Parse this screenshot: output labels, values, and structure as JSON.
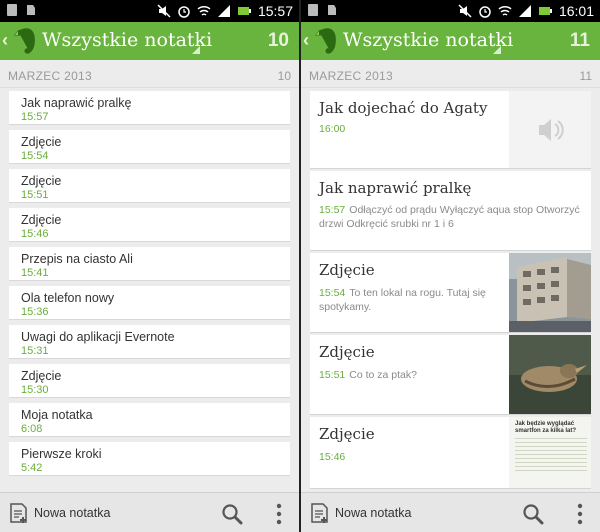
{
  "left": {
    "status_time": "15:57",
    "title": "Wszystkie notatki",
    "count": "10",
    "section": {
      "month": "MARZEC 2013",
      "count": "10"
    },
    "notes": [
      {
        "title": "Jak naprawić pralkę",
        "time": "15:57"
      },
      {
        "title": "Zdjęcie",
        "time": "15:54"
      },
      {
        "title": "Zdjęcie",
        "time": "15:51"
      },
      {
        "title": "Zdjęcie",
        "time": "15:46"
      },
      {
        "title": "Przepis na ciasto Ali",
        "time": "15:41"
      },
      {
        "title": "Ola telefon nowy",
        "time": "15:36"
      },
      {
        "title": "Uwagi do aplikacji Evernote",
        "time": "15:31"
      },
      {
        "title": "Zdjęcie",
        "time": "15:30"
      },
      {
        "title": "Moja notatka",
        "time": "6:08"
      },
      {
        "title": "Pierwsze kroki",
        "time": "5:42"
      }
    ],
    "new_note_label": "Nowa notatka"
  },
  "right": {
    "status_time": "16:01",
    "title": "Wszystkie notatki",
    "count": "11",
    "section": {
      "month": "MARZEC 2013",
      "count": "11"
    },
    "notes": [
      {
        "title": "Jak dojechać do Agaty",
        "time": "16:00",
        "snippet": "",
        "thumb": "audio-icon"
      },
      {
        "title": "Jak naprawić pralkę",
        "time": "15:57",
        "snippet": "Odłączyć od prądu Wyłączyć aqua stop Otworzyć drzwi Odkręcić srubki nr 1 i 6",
        "thumb": ""
      },
      {
        "title": "Zdjęcie",
        "time": "15:54",
        "snippet": "To ten lokal na rogu. Tutaj się spotykamy.",
        "thumb": "building-photo"
      },
      {
        "title": "Zdjęcie",
        "time": "15:51",
        "snippet": "Co to za ptak?",
        "thumb": "bird-photo"
      },
      {
        "title": "Zdjęcie",
        "time": "15:46",
        "snippet": "",
        "thumb": "article-photo"
      }
    ],
    "article_thumb_headline": "Jak będzie wyglądać smartfon za kilka lat?",
    "new_note_label": "Nowa notatka"
  },
  "colors": {
    "accent": "#69b33f",
    "time_green": "#6aae3c"
  },
  "icons": [
    "evernote-logo-icon",
    "new-note-icon",
    "search-icon",
    "overflow-menu-icon",
    "audio-icon"
  ]
}
